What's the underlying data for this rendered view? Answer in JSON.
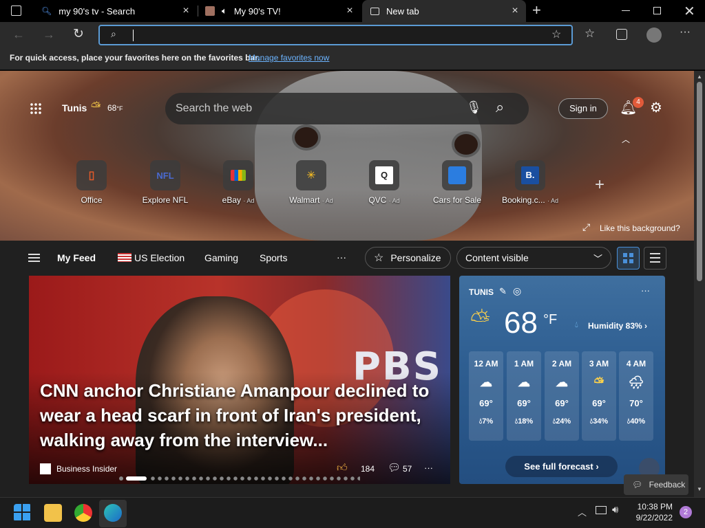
{
  "tabs": [
    {
      "title": "my 90's tv - Search"
    },
    {
      "title": "My 90's TV!"
    },
    {
      "title": "New tab"
    }
  ],
  "favbar": {
    "text": "For quick access, place your favorites here on the favorites bar.",
    "link": "Manage favorites now"
  },
  "hero": {
    "city": "Tunis",
    "temp": "68",
    "unit": "°F",
    "search_placeholder": "Search the web",
    "signin": "Sign in",
    "notif_count": "4",
    "like_bg": "Like this background?"
  },
  "quicklinks": [
    {
      "label": "Office",
      "ad": ""
    },
    {
      "label": "Explore NFL",
      "ad": ""
    },
    {
      "label": "eBay",
      "ad": "· Ad"
    },
    {
      "label": "Walmart",
      "ad": "· Ad"
    },
    {
      "label": "QVC",
      "ad": "· Ad"
    },
    {
      "label": "Cars for Sale",
      "ad": ""
    },
    {
      "label": "Booking.c...",
      "ad": "· Ad"
    }
  ],
  "feednav": {
    "myfeed": "My Feed",
    "election": "US Election",
    "gaming": "Gaming",
    "sports": "Sports",
    "more": "···",
    "personalize": "Personalize",
    "content": "Content visible"
  },
  "story": {
    "pbs": "PBS",
    "headline": "CNN anchor Christiane Amanpour declined to wear a head scarf in front of Iran's president, walking away from the interview...",
    "source": "Business Insider",
    "reactions": "184",
    "comments": "57",
    "more": "···"
  },
  "weather": {
    "city": "TUNIS",
    "temp": "68",
    "unit": "°F",
    "humidity": "Humidity 83%",
    "more": "···",
    "hours": [
      {
        "time": "12 AM",
        "temp": "69°",
        "precip": "7%",
        "icon": "cloud"
      },
      {
        "time": "1 AM",
        "temp": "69°",
        "precip": "18%",
        "icon": "cloud"
      },
      {
        "time": "2 AM",
        "temp": "69°",
        "precip": "24%",
        "icon": "cloud"
      },
      {
        "time": "3 AM",
        "temp": "69°",
        "precip": "34%",
        "icon": "partly-cloudy-night"
      },
      {
        "time": "4 AM",
        "temp": "70°",
        "precip": "40%",
        "icon": "rain-cloud"
      }
    ],
    "forecast_btn": "See full forecast"
  },
  "feedback": "Feedback",
  "taskbar": {
    "time": "10:38 PM",
    "date": "9/22/2022",
    "badge": "2"
  }
}
